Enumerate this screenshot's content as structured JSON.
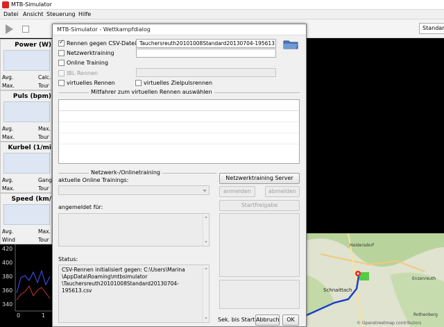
{
  "app": {
    "title": "MTB-Simulator",
    "menu": [
      "Datei",
      "Ansicht",
      "Steuerung",
      "Hilfe"
    ],
    "toolbar_profile": "Standard"
  },
  "panels": {
    "power": {
      "title": "Power (W)",
      "labels": [
        "Avg.",
        "Calc.",
        "Max.",
        "Tour"
      ]
    },
    "pulse": {
      "title": "Puls (bpm)",
      "labels": [
        "Avg.",
        "Max.",
        "Max.",
        "Tour"
      ]
    },
    "crank": {
      "title": "Kurbel (1/mi",
      "labels": [
        "Avg.",
        "Gang",
        "Max.",
        "Tour"
      ]
    },
    "speed": {
      "title": "Speed (km/",
      "labels": [
        "Avg.",
        "Max.",
        "Wind",
        "Tour"
      ]
    }
  },
  "graph": {
    "y_ticks": [
      "420",
      "400",
      "380",
      "360",
      "340"
    ],
    "x_ticks": [
      "0",
      "1"
    ]
  },
  "dialog": {
    "title": "MTB-Simulator - Wettkampfdialog",
    "csv_race": {
      "label": "Rennen gegen CSV-Datei",
      "checked": true,
      "file": "Tauchersreuth20101008Standard20130704-195613.csv"
    },
    "network_training": {
      "label": "Netzwerktraining",
      "checked": false
    },
    "online_training": {
      "label": "Online Training",
      "checked": false
    },
    "ibl_race": {
      "label": "IBL Rennen",
      "checked": false,
      "disabled": true
    },
    "virtual_race": {
      "label": "virtuelles Rennen",
      "checked": false
    },
    "virtual_target_pulse": {
      "label": "virtuelles Zielpulsrennen",
      "checked": false
    },
    "section_opponents": "Mitfahrer zum virtuellen Rennen auswählen",
    "section_network": "Netzwerk-/Onlinetraining",
    "online_trainings_label": "aktuelle Online Trainings:",
    "registered_label": "angemeldet für:",
    "status_label": "Status:",
    "status_text": "CSV-Rennen initialisiert gegen: C:\\Users\\Marina\\AppData\\Roaming\\mtbsimulator\\Tauchersreuth20101008Standard20130704-195613.csv",
    "status_lines": [
      "CSV-Rennen initialisiert gegen: C:\\Users\\Marina",
      "\\AppData\\Roaming\\mtbsimulator",
      "\\Tauchersreuth20101008Standard20130704-195613.csv"
    ],
    "buttons": {
      "network_server": "Netzwerktraining Server",
      "register": "anmelden",
      "unregister": "abmelden",
      "start_release": "Startfreigabe",
      "seconds_to_start": "Sek. bis Start..",
      "cancel": "Abbruch",
      "ok": "OK"
    }
  },
  "map": {
    "labels": [
      "Heidersdorf",
      "Schnaittach",
      "Enzenreuth",
      "Rothenberg"
    ],
    "attribution": "© Openstreetmap contributors"
  },
  "colors": {
    "accent_red": "#cc2222",
    "route_blue": "#1a3fd0",
    "graph_bg": "#000000"
  }
}
